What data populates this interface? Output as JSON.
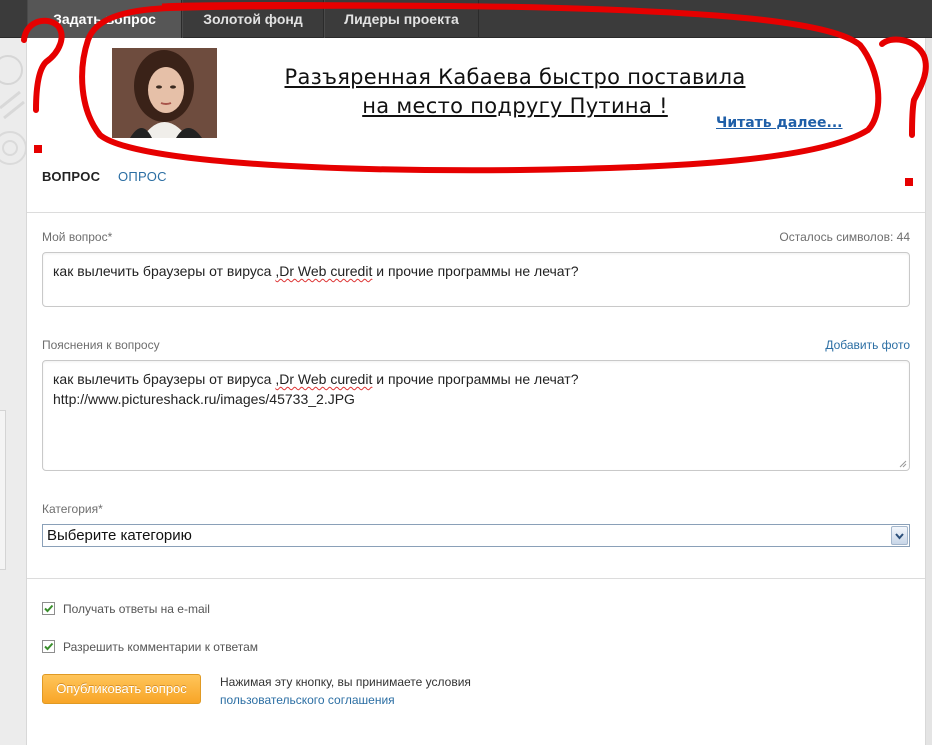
{
  "nav": {
    "tabs": [
      {
        "label": "Задать вопрос",
        "active": true
      },
      {
        "label": "Золотой фонд",
        "active": false
      },
      {
        "label": "Лидеры проекта",
        "active": false
      }
    ]
  },
  "banner": {
    "headline_line1": "Разъяренная Кабаева быстро поставила",
    "headline_line2": "на место подругу Путина !",
    "read_more": "Читать далее..."
  },
  "form_tabs": {
    "question": "ВОПРОС",
    "poll": "ОПРОС"
  },
  "question": {
    "label": "Мой вопрос*",
    "counter": "Осталось символов: 44",
    "value_prefix": "как вылечить браузеры от вируса ",
    "value_typo": ",Dr Web curedit",
    "value_suffix": " и прочие программы не лечат?"
  },
  "details": {
    "label": "Пояснения к вопросу",
    "add_photo": "Добавить фото",
    "line1_prefix": "как вылечить браузеры от вируса ",
    "line1_typo": ",Dr Web curedit",
    "line1_suffix": " и прочие программы не лечат?",
    "line2": "http://www.pictureshack.ru/images/45733_2.JPG"
  },
  "category": {
    "label": "Категория*",
    "selected": "Выберите категорию"
  },
  "options": {
    "email_answers": {
      "label": "Получать ответы на e-mail",
      "checked": true
    },
    "allow_comments": {
      "label": "Разрешить комментарии к ответам",
      "checked": true
    }
  },
  "publish": {
    "button": "Опубликовать вопрос",
    "terms_text": "Нажимая эту кнопку, вы принимаете условия",
    "terms_link": "пользовательского соглашения"
  },
  "colors": {
    "accent_orange": "#f8a527",
    "link_blue": "#2b6ea3",
    "annotation_red": "#e60000",
    "nav_dark": "#3b3b3b"
  }
}
